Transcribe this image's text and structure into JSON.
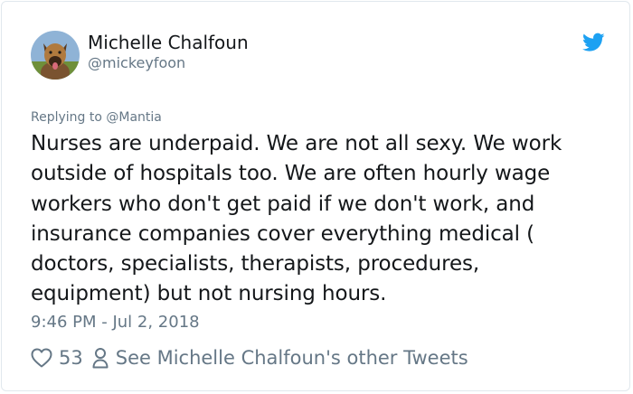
{
  "tweet": {
    "author_name": "Michelle Chalfoun",
    "author_handle": "@mickeyfoon",
    "reply_prefix": "Replying to",
    "reply_mention": "@Mantia",
    "text_lines": [
      "Nurses are underpaid. We are not all sexy. We work",
      "outside of hospitals too. We are often hourly wage",
      "workers who don't get paid if we don't work, and",
      "insurance companies cover everything medical (",
      "doctors, specialists, therapists, procedures,",
      "equipment) but not nursing hours."
    ],
    "timestamp": "9:46 PM - Jul 2, 2018",
    "like_count": "53",
    "profile_link": "See Michelle Chalfoun's other Tweets"
  },
  "icons": {
    "avatar": "dog-avatar",
    "brand": "twitter-bird-icon",
    "like": "heart-icon",
    "profile": "person-icon"
  },
  "colors": {
    "brand_blue": "#1da1f2",
    "secondary_text": "#657786",
    "primary_text": "#14171a",
    "border": "#e1e8ed"
  }
}
